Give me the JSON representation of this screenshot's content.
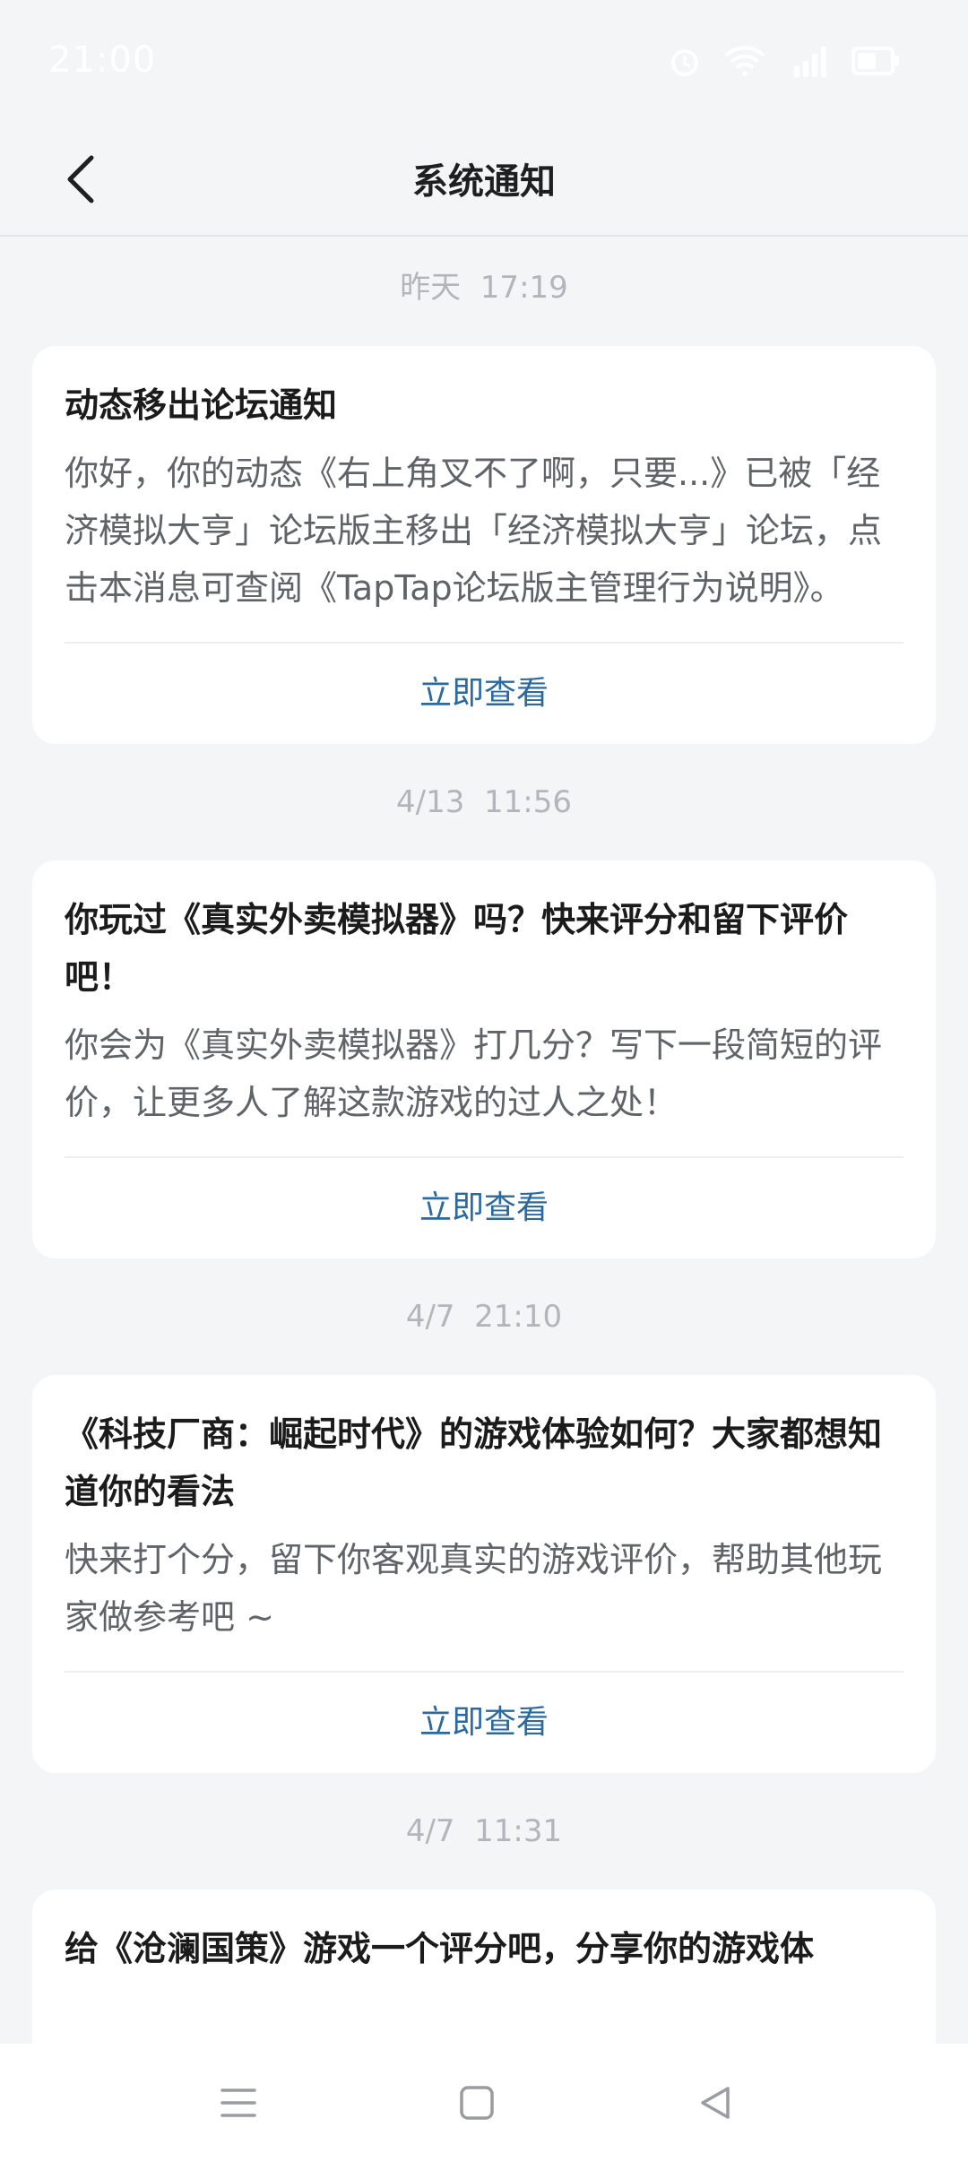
{
  "status_bar": {
    "time": "21:00"
  },
  "header": {
    "title": "系统通知"
  },
  "notifications": [
    {
      "time": "昨天  17:19",
      "title": "动态移出论坛通知",
      "body": "你好，你的动态《右上角叉不了啊，只要...》已被「经济模拟大亨」论坛版主移出「经济模拟大亨」论坛，点击本消息可查阅《TapTap论坛版主管理行为说明》。",
      "action": "立即查看"
    },
    {
      "time": "4/13  11:56",
      "title": "你玩过《真实外卖模拟器》吗？快来评分和留下评价吧！",
      "body": "你会为《真实外卖模拟器》打几分？写下一段简短的评价，让更多人了解这款游戏的过人之处！",
      "action": "立即查看"
    },
    {
      "time": "4/7  21:10",
      "title": "《科技厂商：崛起时代》的游戏体验如何？大家都想知道你的看法",
      "body": "快来打个分，留下你客观真实的游戏评价，帮助其他玩家做参考吧 ~",
      "action": "立即查看"
    },
    {
      "time": "4/7  11:31",
      "title": "给《沧澜国策》游戏一个评分吧，分享你的游戏体",
      "body": "",
      "action": ""
    }
  ]
}
